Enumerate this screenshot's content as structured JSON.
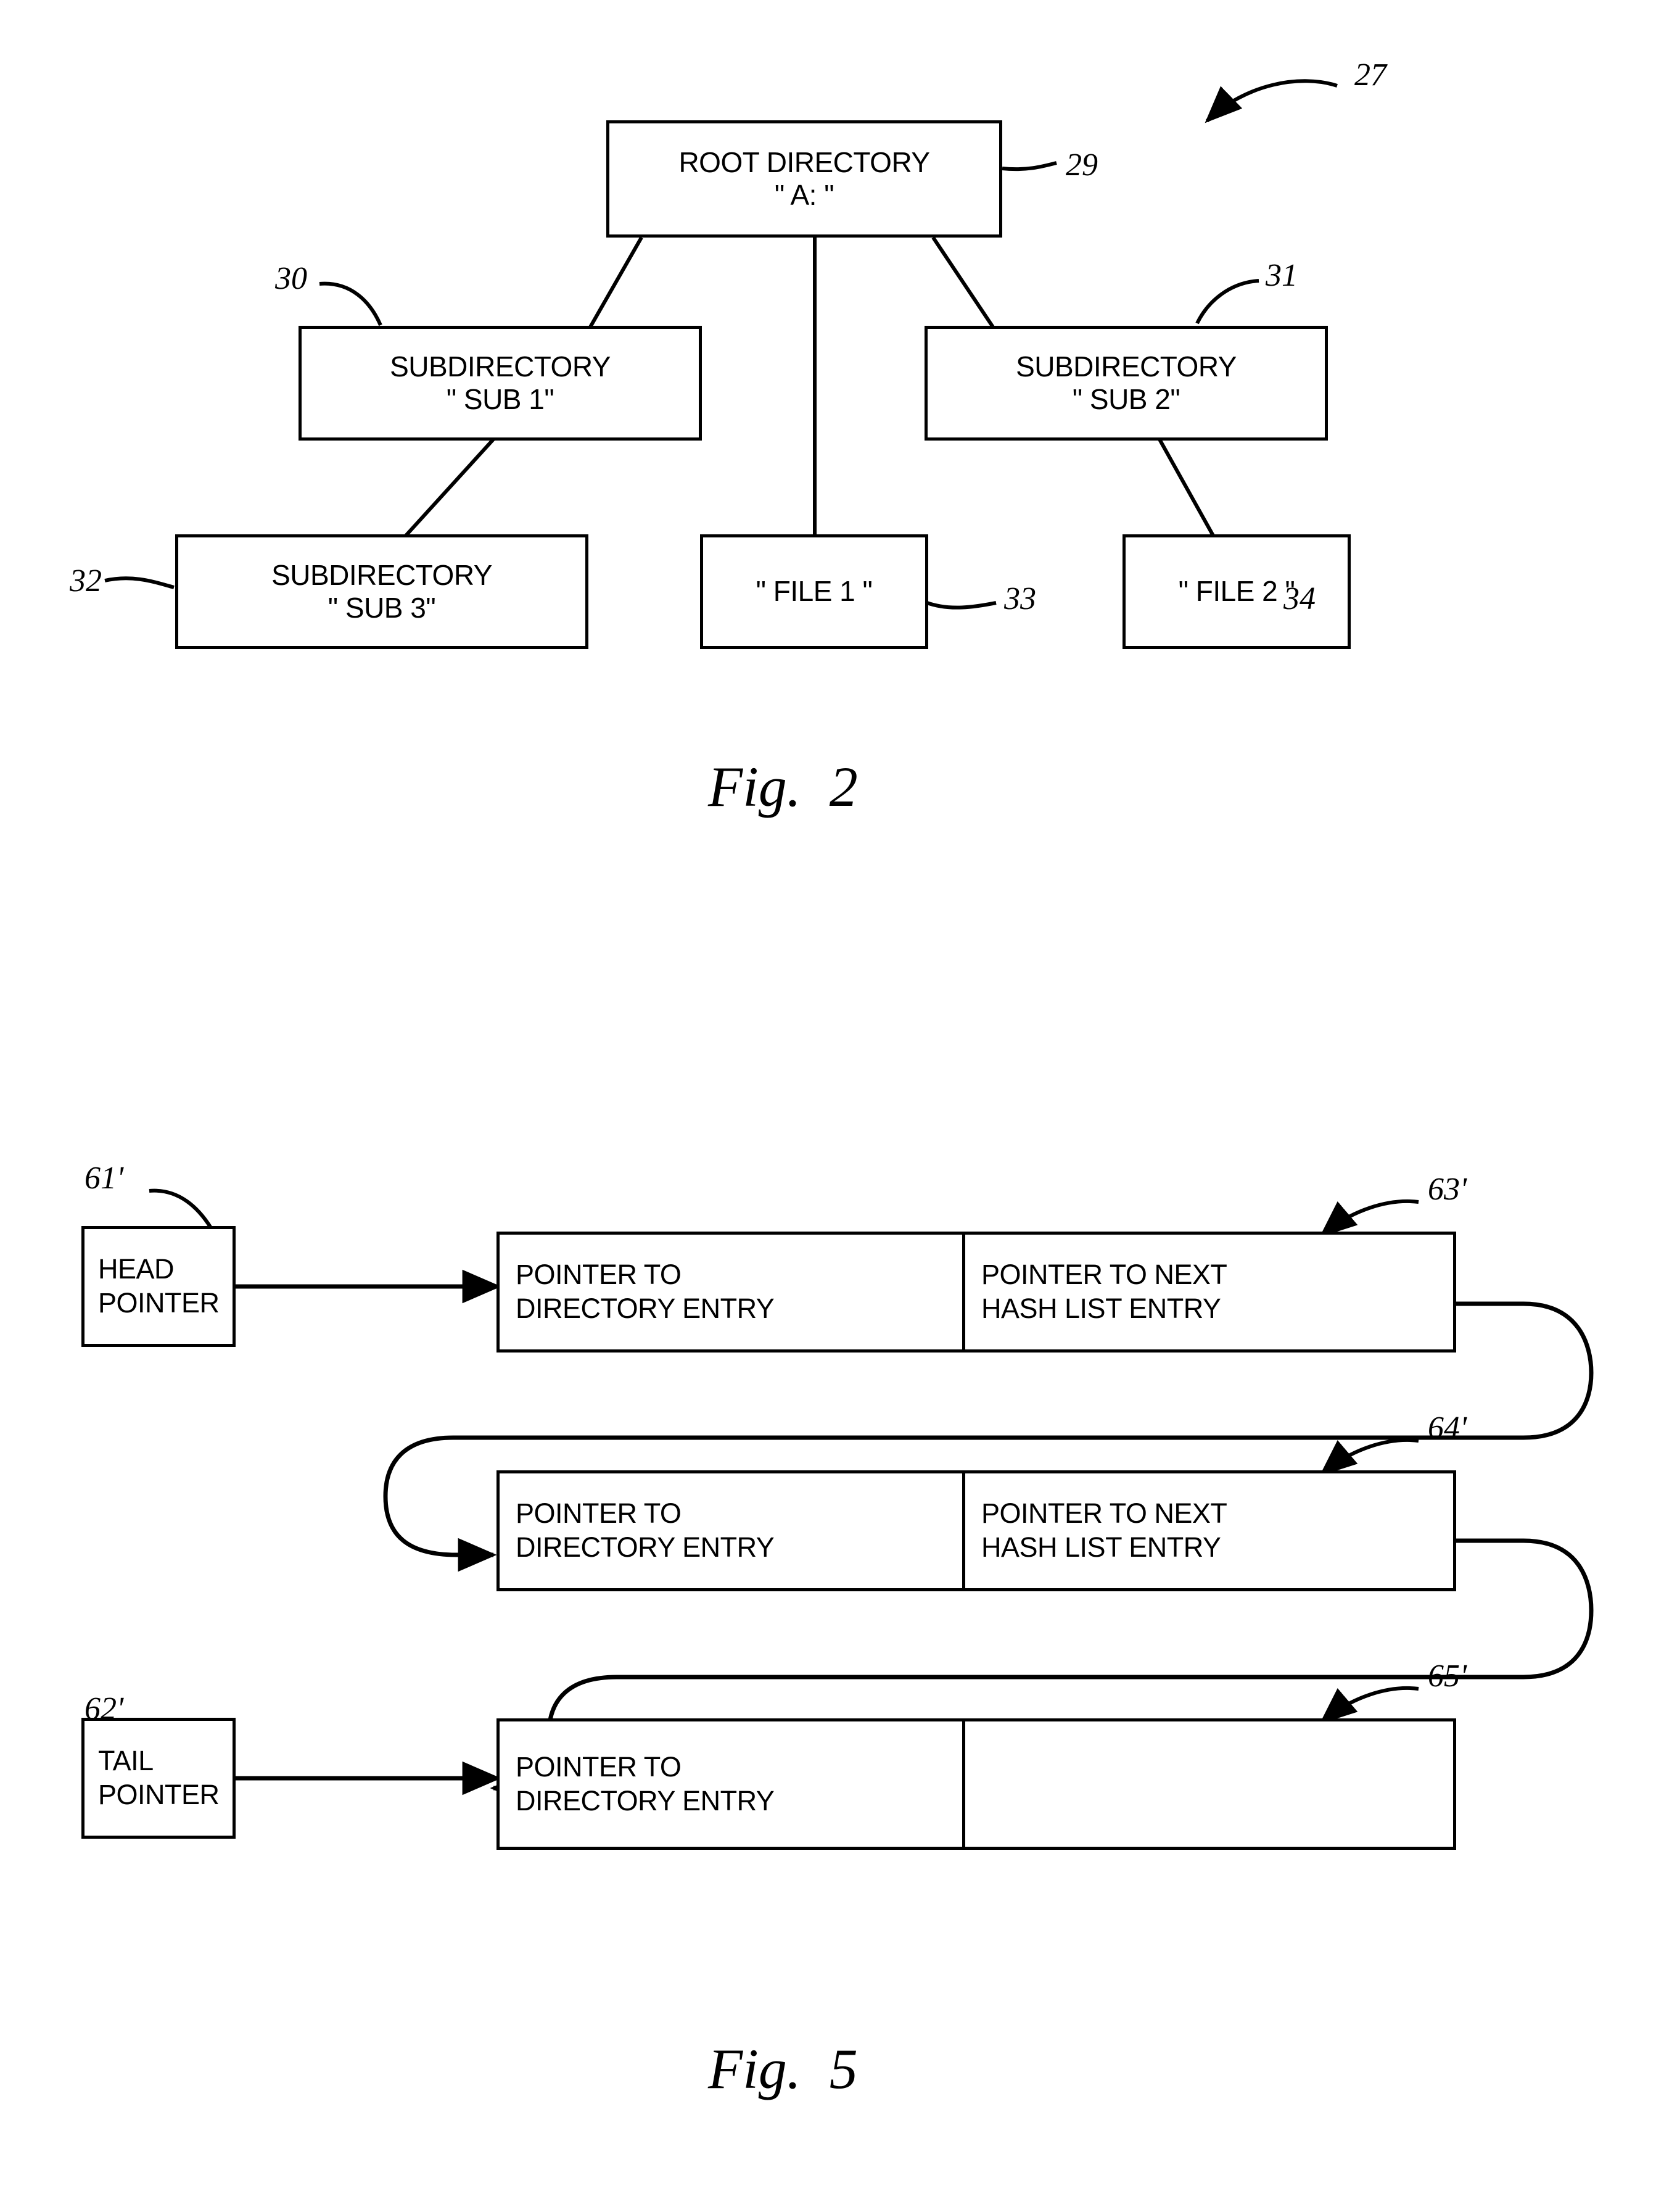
{
  "sheet": {
    "figures": [
      {
        "caption_prefix": "Fig.",
        "caption_number": "2",
        "assembly_ref": "27",
        "nodes": [
          {
            "ref": "29",
            "line1": "ROOT DIRECTORY",
            "line2": "\" A: \""
          },
          {
            "ref": "30",
            "line1": "SUBDIRECTORY",
            "line2": "\" SUB 1\""
          },
          {
            "ref": "31",
            "line1": "SUBDIRECTORY",
            "line2": "\" SUB 2\""
          },
          {
            "ref": "32",
            "line1": "SUBDIRECTORY",
            "line2": "\" SUB 3\""
          },
          {
            "ref": "33",
            "line1": "\" FILE 1 \"",
            "line2": ""
          },
          {
            "ref": "34",
            "line1": "\" FILE 2 \"",
            "line2": ""
          }
        ]
      },
      {
        "caption_prefix": "Fig.",
        "caption_number": "5",
        "head_pointer": {
          "ref": "61'",
          "line1": "HEAD",
          "line2": "POINTER"
        },
        "tail_pointer": {
          "ref": "62'",
          "line1": "TAIL",
          "line2": "POINTER"
        },
        "entries": [
          {
            "ref": "63'",
            "left_line1": "POINTER TO",
            "left_line2": "DIRECTORY ENTRY",
            "right_line1": "POINTER TO NEXT",
            "right_line2": "HASH LIST ENTRY",
            "right_null": false
          },
          {
            "ref": "64'",
            "left_line1": "POINTER TO",
            "left_line2": "DIRECTORY ENTRY",
            "right_line1": "POINTER TO NEXT",
            "right_line2": "HASH LIST ENTRY",
            "right_null": false
          },
          {
            "ref": "65'",
            "left_line1": "POINTER TO",
            "left_line2": "DIRECTORY ENTRY",
            "right_line1": "",
            "right_line2": "",
            "right_null": true
          }
        ]
      }
    ]
  },
  "colors": {
    "ink": "#000000",
    "paper": "#ffffff"
  }
}
